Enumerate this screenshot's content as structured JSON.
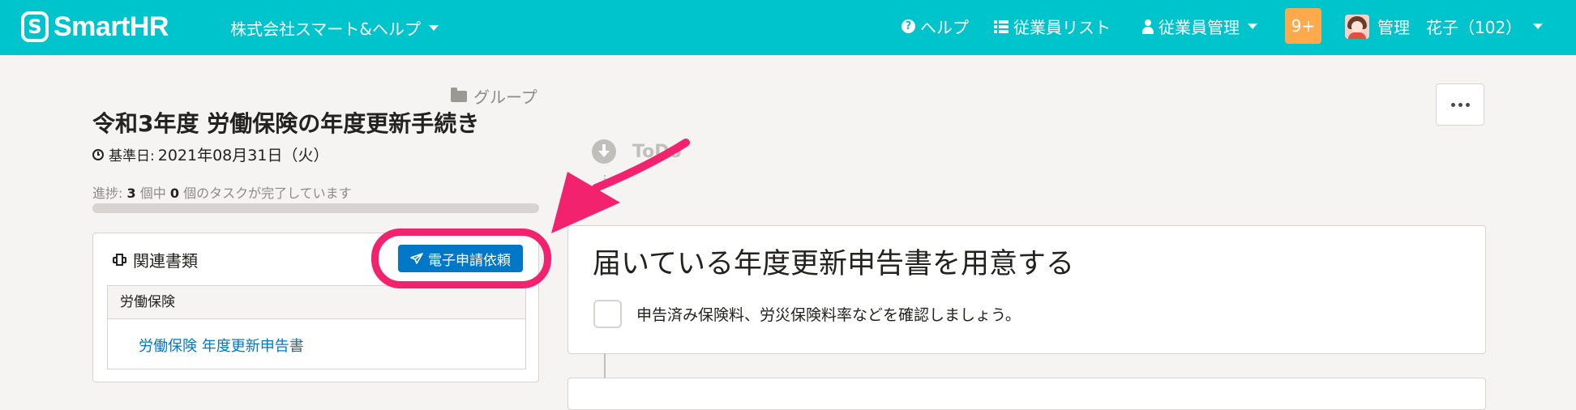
{
  "header": {
    "logo_text": "SmartHR",
    "logo_mark": "S",
    "company": "株式会社スマート&ヘルプ",
    "nav": {
      "help": "ヘルプ",
      "employee_list": "従業員リスト",
      "employee_manage": "従業員管理"
    },
    "badge": "9+",
    "user": "管理　花子（102）",
    "icons": [
      "question-circle-icon",
      "list-icon",
      "user-icon",
      "caret-down-icon"
    ],
    "colors": {
      "bar": "#00c4cc",
      "badge": "#ffa94d"
    }
  },
  "procedure": {
    "group_label": "グループ",
    "title": "令和3年度 労働保険の年度更新手続き",
    "base_date_label": "基準日:",
    "base_date_value": "2021年08月31日（火）",
    "progress": {
      "prefix": "進捗:",
      "total": "3",
      "mid": "個中",
      "done": "0",
      "suffix": "個のタスクが完了しています",
      "fraction": 0
    }
  },
  "docs_panel": {
    "title": "関連書類",
    "request_button": "電子申請依頼",
    "category": "労働保険",
    "document_link": "労働保険 年度更新申告書"
  },
  "todo": {
    "label": "ToDo",
    "task_title": "届いている年度更新申告書を用意する",
    "task_desc": "申告済み保険料、労災保険料率などを確認しましょう。"
  },
  "annotation": {
    "color": "#f2226e"
  }
}
